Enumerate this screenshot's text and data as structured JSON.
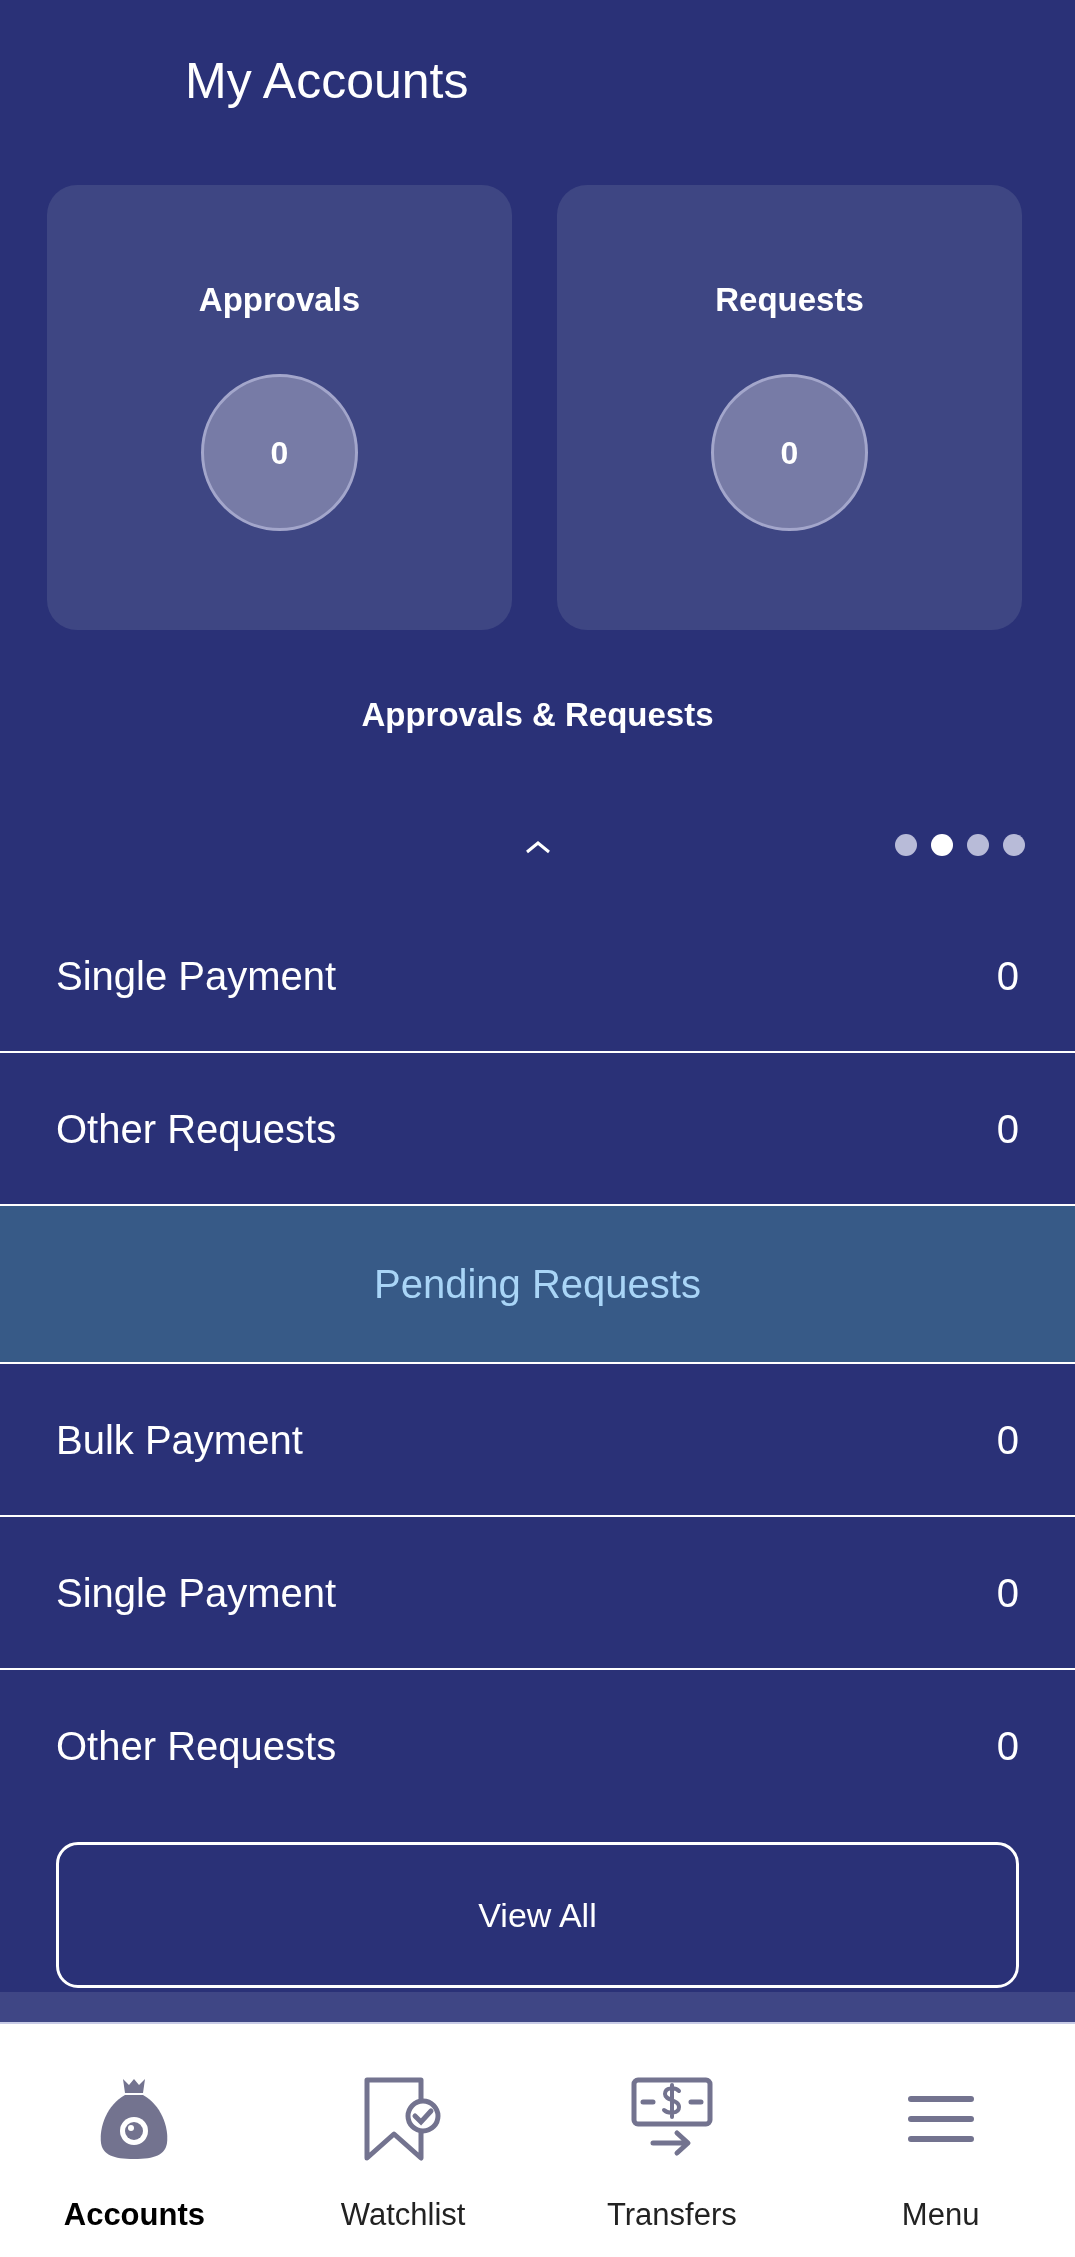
{
  "header": {
    "title": "My Accounts"
  },
  "cards": [
    {
      "label": "Approvals",
      "count": "0"
    },
    {
      "label": "Requests",
      "count": "0"
    }
  ],
  "carousel": {
    "caption": "Approvals & Requests",
    "pages": [
      {
        "selected": false
      },
      {
        "selected": true
      },
      {
        "selected": false
      },
      {
        "selected": false
      }
    ]
  },
  "rows": [
    {
      "kind": "row",
      "label": "Single Payment",
      "value": "0"
    },
    {
      "kind": "row",
      "label": "Other Requests",
      "value": "0"
    },
    {
      "kind": "section",
      "label": "Pending Requests"
    },
    {
      "kind": "row",
      "label": "Bulk Payment",
      "value": "0"
    },
    {
      "kind": "row",
      "label": "Single Payment",
      "value": "0"
    },
    {
      "kind": "row",
      "label": "Other Requests",
      "value": "0"
    }
  ],
  "view_all_button": "View All",
  "bottom_nav": [
    {
      "kind": "bag",
      "label": "Accounts",
      "selected": true
    },
    {
      "kind": "bookmark",
      "label": "Watchlist",
      "selected": false
    },
    {
      "kind": "transfer",
      "label": "Transfers",
      "selected": false
    },
    {
      "kind": "menu",
      "label": "Menu",
      "selected": false
    }
  ]
}
